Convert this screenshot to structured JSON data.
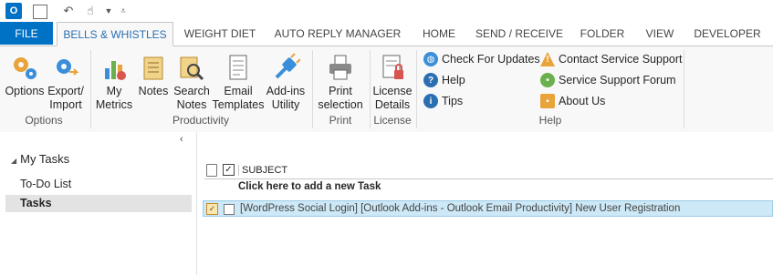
{
  "qat": {
    "outlook_logo": "O",
    "icons": [
      "outlook-icon",
      "send-receive-icon",
      "undo-icon",
      "touch-mode-icon",
      "dropdown-icon",
      "customize-icon"
    ]
  },
  "tabs": [
    "FILE",
    "BELLS & WHISTLES",
    "WEIGHT DIET",
    "AUTO REPLY MANAGER",
    "HOME",
    "SEND / RECEIVE",
    "FOLDER",
    "VIEW",
    "DEVELOPER"
  ],
  "ribbon": {
    "options": {
      "options_label": "Options",
      "export_label": "Export/\nImport",
      "group": "Options"
    },
    "productivity": {
      "my_metrics": "My\nMetrics",
      "notes": "Notes",
      "search_notes": "Search\nNotes",
      "email_templates": "Email\nTemplates",
      "addins_utility": "Add-ins\nUtility",
      "group": "Productivity"
    },
    "print": {
      "print_selection": "Print\nselection",
      "group": "Print"
    },
    "license": {
      "license_details": "License\nDetails",
      "group": "License"
    },
    "help": {
      "check_updates": "Check For Updates",
      "help": "Help",
      "tips": "Tips",
      "contact_support": "Contact Service Support",
      "support_forum": "Service Support Forum",
      "about_us": "About Us",
      "group": "Help"
    }
  },
  "sidebar": {
    "collapse_glyph": "‹",
    "header": "My Tasks",
    "items": [
      "To-Do List",
      "Tasks"
    ]
  },
  "tasklist": {
    "column_subject": "SUBJECT",
    "add_placeholder": "Click here to add a new Task",
    "rows": [
      {
        "subject": "[WordPress Social Login] [Outlook Add-ins - Outlook Email Productivity] New User Registration"
      }
    ]
  },
  "colors": {
    "accent": "#0072c6",
    "tab_active_text": "#2b6fb3",
    "selection": "#cde8f6"
  }
}
